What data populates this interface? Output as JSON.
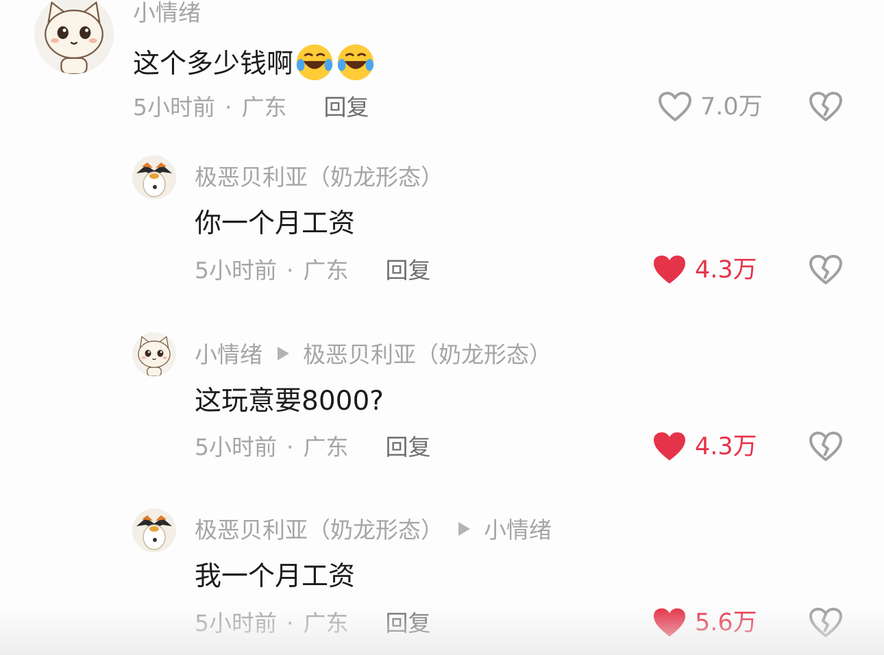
{
  "comments": [
    {
      "user": "小情绪",
      "reply_to": "",
      "text": "这个多少钱啊",
      "emoji": "rolling-on-floor-laughing",
      "time": "5小时前",
      "separator": "·",
      "location": "广东",
      "reply_label": "回复",
      "likes": "7.0万",
      "liked": false,
      "avatar": "cat-avatar"
    },
    {
      "user": "极恶贝利亚（奶龙形态）",
      "reply_to": "",
      "text": "你一个月工资",
      "time": "5小时前",
      "separator": "·",
      "location": "广东",
      "reply_label": "回复",
      "likes": "4.3万",
      "liked": true,
      "avatar": "penguin-avatar"
    },
    {
      "user": "小情绪",
      "reply_to": "极恶贝利亚（奶龙形态）",
      "text": "这玩意要8000?",
      "time": "5小时前",
      "separator": "·",
      "location": "广东",
      "reply_label": "回复",
      "likes": "4.3万",
      "liked": true,
      "avatar": "cat-avatar"
    },
    {
      "user": "极恶贝利亚（奶龙形态）",
      "reply_to": "小情绪",
      "text": "我一个月工资",
      "time": "5小时前",
      "separator": "·",
      "location": "广东",
      "reply_label": "回复",
      "likes": "5.6万",
      "liked": true,
      "avatar": "penguin-avatar"
    }
  ],
  "colors": {
    "like_active": "#e53349",
    "muted_text": "#a5a5a5",
    "primary_text": "#1b1b1b",
    "reply_text": "#6e6e6e"
  }
}
